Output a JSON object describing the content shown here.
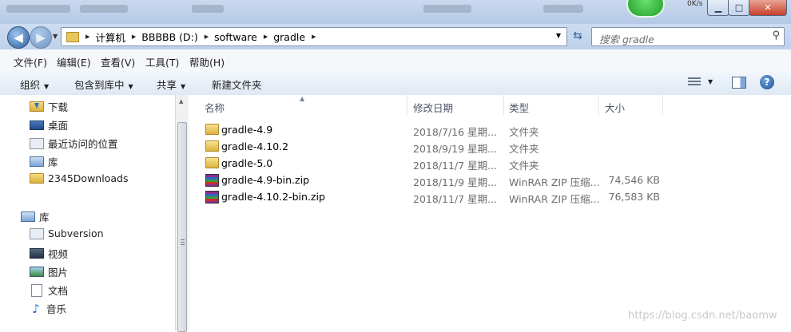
{
  "window": {
    "speed_label": "0K/s",
    "buttons": {
      "minimize": "▁",
      "maximize": "□",
      "close": "✕"
    }
  },
  "nav": {
    "back_glyph": "◀",
    "forward_glyph": "▶",
    "breadcrumb": [
      "计算机",
      "BBBBB (D:)",
      "software",
      "gradle"
    ],
    "search_placeholder": "搜索 gradle"
  },
  "menubar": [
    "文件(F)",
    "编辑(E)",
    "查看(V)",
    "工具(T)",
    "帮助(H)"
  ],
  "toolbar": {
    "organize": "组织",
    "include_in_library": "包含到库中",
    "share": "共享",
    "new_folder": "新建文件夹"
  },
  "sidebar": {
    "favorites": [
      "下载",
      "桌面",
      "最近访问的位置",
      "库",
      "2345Downloads"
    ],
    "libraries_header": "库",
    "libraries": [
      "Subversion",
      "视频",
      "图片",
      "文档",
      "音乐"
    ]
  },
  "columns": {
    "name": "名称",
    "modified": "修改日期",
    "type": "类型",
    "size": "大小"
  },
  "files": [
    {
      "name": "gradle-4.9",
      "date": "2018/7/16 星期...",
      "type": "文件夹",
      "size": "",
      "icon": "folder-icon"
    },
    {
      "name": "gradle-4.10.2",
      "date": "2018/9/19 星期...",
      "type": "文件夹",
      "size": "",
      "icon": "folder-icon"
    },
    {
      "name": "gradle-5.0",
      "date": "2018/11/7 星期...",
      "type": "文件夹",
      "size": "",
      "icon": "folder-icon"
    },
    {
      "name": "gradle-4.9-bin.zip",
      "date": "2018/11/9 星期...",
      "type": "WinRAR ZIP 压缩...",
      "size": "74,546 KB",
      "icon": "winrar-zip-icon"
    },
    {
      "name": "gradle-4.10.2-bin.zip",
      "date": "2018/11/7 星期...",
      "type": "WinRAR ZIP 压缩...",
      "size": "76,583 KB",
      "icon": "winrar-zip-icon"
    }
  ],
  "watermark": "https://blog.csdn.net/baomw"
}
